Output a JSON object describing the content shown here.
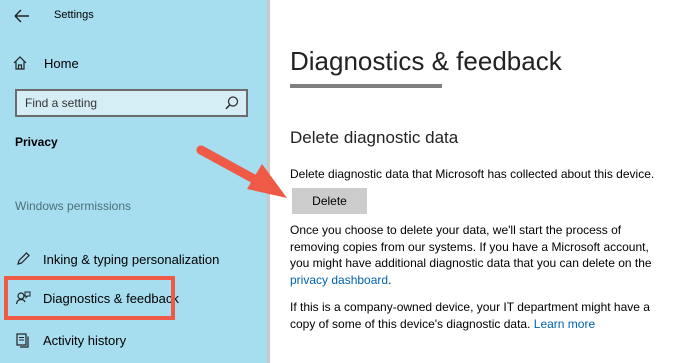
{
  "window": {
    "title": "Settings"
  },
  "sidebar": {
    "home_label": "Home",
    "search_placeholder": "Find a setting",
    "section_label": "Privacy",
    "group_label": "Windows permissions",
    "items": [
      {
        "label": "Inking & typing personalization",
        "icon": "pen-icon"
      },
      {
        "label": "Diagnostics & feedback",
        "icon": "feedback-icon",
        "selected": true
      },
      {
        "label": "Activity history",
        "icon": "activity-history-icon"
      }
    ]
  },
  "main": {
    "title": "Diagnostics & feedback",
    "section_heading": "Delete diagnostic data",
    "delete_description": "Delete diagnostic data that Microsoft has collected about this device.",
    "delete_button_label": "Delete",
    "paragraph1_text": "Once you choose to delete your data, we'll start the process of removing copies from our systems. If you have a Microsoft account, you might have additional diagnostic data that you can delete on the",
    "paragraph1_link": "privacy dashboard",
    "paragraph1_end": ".",
    "paragraph2_text": "If this is a company-owned device, your IT department might have a copy of some of this device's diagnostic data.",
    "paragraph2_link": "Learn more"
  },
  "annotation": {
    "color": "#ef5a47"
  }
}
